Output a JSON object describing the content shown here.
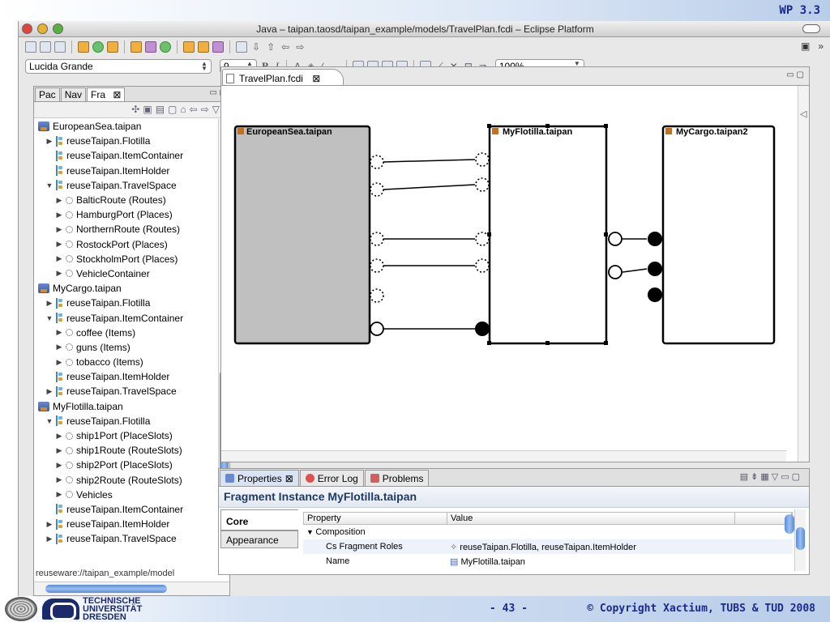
{
  "slide": {
    "wp_label": "WP 3.3",
    "page_number": "- 43 -",
    "copyright": "© Copyright Xactium, TUBS & TUD 2008",
    "tud_logo_lines": [
      "TECHNISCHE",
      "UNIVERSITÄT",
      "DRESDEN"
    ]
  },
  "window": {
    "title": "Java – taipan.taosd/taipan_example/models/TravelPlan.fcdi – Eclipse Platform"
  },
  "toolbar2": {
    "font_value": "Lucida Grande",
    "size_value": "9",
    "zoom_value": "100%",
    "bold": "B",
    "italic": "I",
    "font_a": "A"
  },
  "left_panel": {
    "tabs": [
      {
        "label": "Pac"
      },
      {
        "label": "Nav"
      },
      {
        "label": "Fra",
        "close": "⊠"
      }
    ],
    "tree": [
      {
        "level": 0,
        "icon": "pkg",
        "twisty": "",
        "label": "EuropeanSea.taipan"
      },
      {
        "level": 1,
        "icon": "role",
        "twisty": "▶",
        "label": "reuseTaipan.Flotilla"
      },
      {
        "level": 1,
        "icon": "role",
        "twisty": "",
        "label": "reuseTaipan.ItemContainer"
      },
      {
        "level": 1,
        "icon": "role",
        "twisty": "",
        "label": "reuseTaipan.ItemHolder"
      },
      {
        "level": 1,
        "icon": "role",
        "twisty": "▼",
        "label": "reuseTaipan.TravelSpace"
      },
      {
        "level": 2,
        "icon": "slot",
        "twisty": "▶",
        "label": "BalticRoute (Routes)"
      },
      {
        "level": 2,
        "icon": "slot",
        "twisty": "▶",
        "label": "HamburgPort (Places)"
      },
      {
        "level": 2,
        "icon": "slot",
        "twisty": "▶",
        "label": "NorthernRoute (Routes)"
      },
      {
        "level": 2,
        "icon": "slot",
        "twisty": "▶",
        "label": "RostockPort (Places)"
      },
      {
        "level": 2,
        "icon": "slot",
        "twisty": "▶",
        "label": "StockholmPort (Places)"
      },
      {
        "level": 2,
        "icon": "slot",
        "twisty": "▶",
        "label": "VehicleContainer"
      },
      {
        "level": 0,
        "icon": "pkg",
        "twisty": "",
        "label": "MyCargo.taipan"
      },
      {
        "level": 1,
        "icon": "role",
        "twisty": "▶",
        "label": "reuseTaipan.Flotilla"
      },
      {
        "level": 1,
        "icon": "role",
        "twisty": "▼",
        "label": "reuseTaipan.ItemContainer"
      },
      {
        "level": 2,
        "icon": "slot",
        "twisty": "▶",
        "label": "coffee (Items)"
      },
      {
        "level": 2,
        "icon": "slot",
        "twisty": "▶",
        "label": "guns (Items)"
      },
      {
        "level": 2,
        "icon": "slot",
        "twisty": "▶",
        "label": "tobacco (Items)"
      },
      {
        "level": 1,
        "icon": "role",
        "twisty": "",
        "label": "reuseTaipan.ItemHolder"
      },
      {
        "level": 1,
        "icon": "role",
        "twisty": "▶",
        "label": "reuseTaipan.TravelSpace"
      },
      {
        "level": 0,
        "icon": "pkg",
        "twisty": "",
        "label": "MyFlotilla.taipan"
      },
      {
        "level": 1,
        "icon": "role",
        "twisty": "▼",
        "label": "reuseTaipan.Flotilla"
      },
      {
        "level": 2,
        "icon": "slot",
        "twisty": "▶",
        "label": "ship1Port (PlaceSlots)"
      },
      {
        "level": 2,
        "icon": "slot",
        "twisty": "▶",
        "label": "ship1Route (RouteSlots)"
      },
      {
        "level": 2,
        "icon": "slot",
        "twisty": "▶",
        "label": "ship2Port (PlaceSlots)"
      },
      {
        "level": 2,
        "icon": "slot",
        "twisty": "▶",
        "label": "ship2Route (RouteSlots)"
      },
      {
        "level": 2,
        "icon": "slot",
        "twisty": "▶",
        "label": "Vehicles"
      },
      {
        "level": 1,
        "icon": "role",
        "twisty": "",
        "label": "reuseTaipan.ItemContainer"
      },
      {
        "level": 1,
        "icon": "role",
        "twisty": "▶",
        "label": "reuseTaipan.ItemHolder"
      },
      {
        "level": 1,
        "icon": "role",
        "twisty": "▶",
        "label": "reuseTaipan.TravelSpace"
      }
    ],
    "status_text": "reuseware://taipan_example/model"
  },
  "editor": {
    "tab_label": "TravelPlan.fcdi",
    "tab_close": "⊠",
    "fragments": [
      {
        "name": "EuropeanSea.taipan"
      },
      {
        "name": "MyFlotilla.taipan"
      },
      {
        "name": "MyCargo.taipan2"
      }
    ]
  },
  "properties": {
    "tabs": [
      "Properties",
      "Error Log",
      "Problems"
    ],
    "tab_close": "⊠",
    "heading": "Fragment Instance MyFlotilla.taipan",
    "side_tabs": [
      "Core",
      "Appearance"
    ],
    "columns": [
      "Property",
      "Value"
    ],
    "rows": [
      {
        "property": "Composition",
        "value": "",
        "group": true
      },
      {
        "property": "Cs Fragment Roles",
        "value": "reuseTaipan.Flotilla, reuseTaipan.ItemHolder",
        "group": false
      },
      {
        "property": "Name",
        "value": "MyFlotilla.taipan",
        "group": false
      }
    ]
  }
}
